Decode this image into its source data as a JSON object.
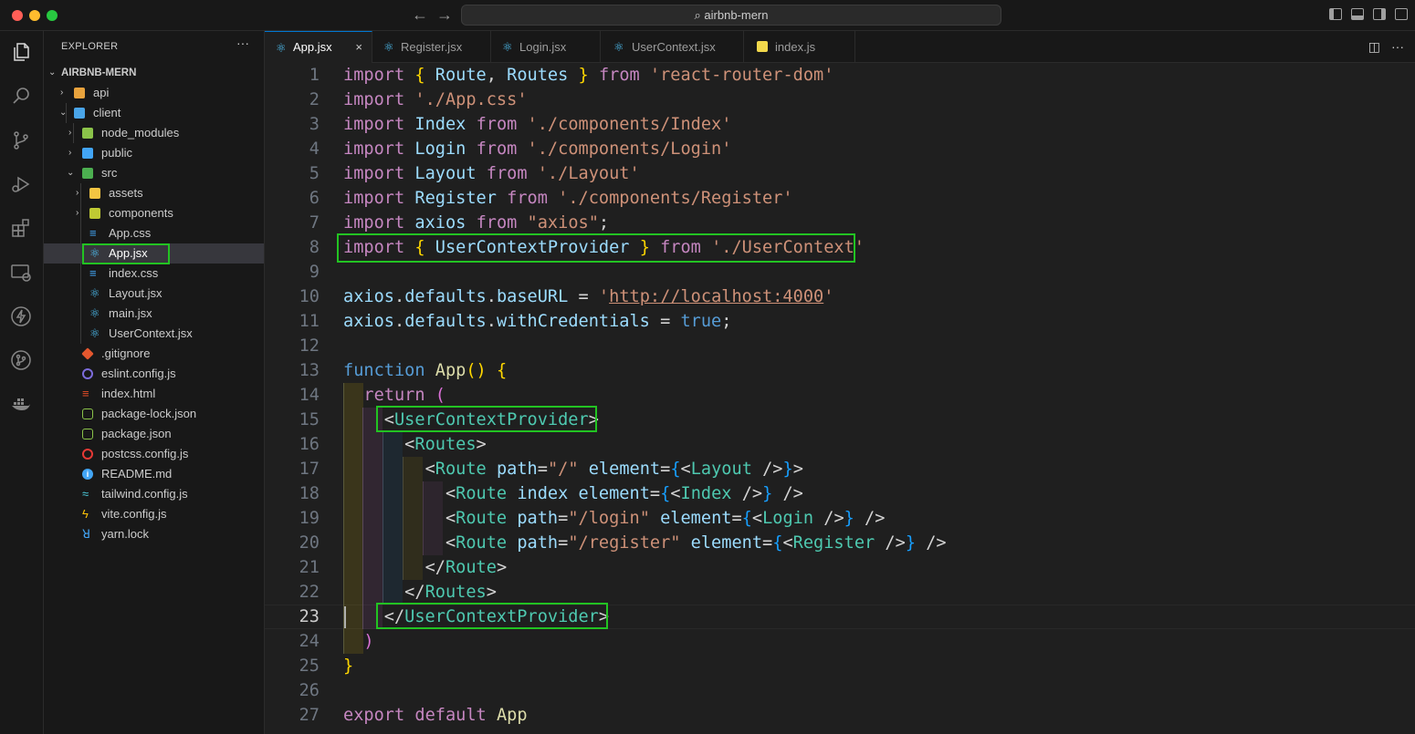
{
  "window": {
    "search_text": "airbnb-mern",
    "back_icon": "arrow-left-icon",
    "forward_icon": "arrow-right-icon"
  },
  "colors": {
    "traffic_close": "#ff5f57",
    "traffic_minimize": "#febc2e",
    "traffic_zoom": "#28c840",
    "annotation_highlight": "#22c322",
    "active_tab_border": "#0078d4"
  },
  "activity_bar": [
    {
      "name": "explorer-icon"
    },
    {
      "name": "search-icon"
    },
    {
      "name": "source-control-icon"
    },
    {
      "name": "run-debug-icon"
    },
    {
      "name": "extensions-icon"
    },
    {
      "name": "remote-explorer-icon"
    },
    {
      "name": "thunder-client-icon"
    },
    {
      "name": "git-graph-icon"
    },
    {
      "name": "docker-icon"
    }
  ],
  "sidebar": {
    "title": "EXPLORER",
    "more": "···",
    "root": "AIRBNB-MERN",
    "items": [
      {
        "label": "api"
      },
      {
        "label": "client"
      },
      {
        "label": "node_modules"
      },
      {
        "label": "public"
      },
      {
        "label": "src"
      },
      {
        "label": "assets"
      },
      {
        "label": "components"
      },
      {
        "label": "App.css"
      },
      {
        "label": "App.jsx"
      },
      {
        "label": "index.css"
      },
      {
        "label": "Layout.jsx"
      },
      {
        "label": "main.jsx"
      },
      {
        "label": "UserContext.jsx"
      },
      {
        "label": ".gitignore"
      },
      {
        "label": "eslint.config.js"
      },
      {
        "label": "index.html"
      },
      {
        "label": "package-lock.json"
      },
      {
        "label": "package.json"
      },
      {
        "label": "postcss.config.js"
      },
      {
        "label": "README.md"
      },
      {
        "label": "tailwind.config.js"
      },
      {
        "label": "vite.config.js"
      },
      {
        "label": "yarn.lock"
      }
    ]
  },
  "tabs": [
    {
      "label": "App.jsx",
      "close": "×"
    },
    {
      "label": "Register.jsx"
    },
    {
      "label": "Login.jsx"
    },
    {
      "label": "UserContext.jsx"
    },
    {
      "label": "index.js"
    }
  ],
  "editor": {
    "current_line": 23,
    "lines": [
      {
        "n": "1",
        "tokens": [
          [
            "kw",
            "import"
          ],
          [
            "plain",
            " "
          ],
          [
            "br1",
            "{"
          ],
          [
            "plain",
            " "
          ],
          [
            "var",
            "Route"
          ],
          [
            "plain",
            ", "
          ],
          [
            "var",
            "Routes"
          ],
          [
            "plain",
            " "
          ],
          [
            "br1",
            "}"
          ],
          [
            "plain",
            " "
          ],
          [
            "kw",
            "from"
          ],
          [
            "plain",
            " "
          ],
          [
            "str",
            "'react-router-dom'"
          ]
        ]
      },
      {
        "n": "2",
        "tokens": [
          [
            "kw",
            "import"
          ],
          [
            "plain",
            " "
          ],
          [
            "str",
            "'./App.css'"
          ]
        ]
      },
      {
        "n": "3",
        "tokens": [
          [
            "kw",
            "import"
          ],
          [
            "plain",
            " "
          ],
          [
            "var",
            "Index"
          ],
          [
            "plain",
            " "
          ],
          [
            "kw",
            "from"
          ],
          [
            "plain",
            " "
          ],
          [
            "str",
            "'./components/Index'"
          ]
        ]
      },
      {
        "n": "4",
        "tokens": [
          [
            "kw",
            "import"
          ],
          [
            "plain",
            " "
          ],
          [
            "var",
            "Login"
          ],
          [
            "plain",
            " "
          ],
          [
            "kw",
            "from"
          ],
          [
            "plain",
            " "
          ],
          [
            "str",
            "'./components/Login'"
          ]
        ]
      },
      {
        "n": "5",
        "tokens": [
          [
            "kw",
            "import"
          ],
          [
            "plain",
            " "
          ],
          [
            "var",
            "Layout"
          ],
          [
            "plain",
            " "
          ],
          [
            "kw",
            "from"
          ],
          [
            "plain",
            " "
          ],
          [
            "str",
            "'./Layout'"
          ]
        ]
      },
      {
        "n": "6",
        "tokens": [
          [
            "kw",
            "import"
          ],
          [
            "plain",
            " "
          ],
          [
            "var",
            "Register"
          ],
          [
            "plain",
            " "
          ],
          [
            "kw",
            "from"
          ],
          [
            "plain",
            " "
          ],
          [
            "str",
            "'./components/Register'"
          ]
        ]
      },
      {
        "n": "7",
        "tokens": [
          [
            "kw",
            "import"
          ],
          [
            "plain",
            " "
          ],
          [
            "var",
            "axios"
          ],
          [
            "plain",
            " "
          ],
          [
            "kw",
            "from"
          ],
          [
            "plain",
            " "
          ],
          [
            "str",
            "\"axios\""
          ],
          [
            "plain",
            ";"
          ]
        ]
      },
      {
        "n": "8",
        "tokens": [
          [
            "kw",
            "import"
          ],
          [
            "plain",
            " "
          ],
          [
            "br1",
            "{"
          ],
          [
            "plain",
            " "
          ],
          [
            "var",
            "UserContextProvider"
          ],
          [
            "plain",
            " "
          ],
          [
            "br1",
            "}"
          ],
          [
            "plain",
            " "
          ],
          [
            "kw",
            "from"
          ],
          [
            "plain",
            " "
          ],
          [
            "str",
            "'./UserContext'"
          ]
        ]
      },
      {
        "n": "9",
        "tokens": []
      },
      {
        "n": "10",
        "tokens": [
          [
            "var",
            "axios"
          ],
          [
            "plain",
            "."
          ],
          [
            "var",
            "defaults"
          ],
          [
            "plain",
            "."
          ],
          [
            "var",
            "baseURL"
          ],
          [
            "plain",
            " = "
          ],
          [
            "str",
            "'"
          ],
          [
            "str url",
            "http://localhost:4000"
          ],
          [
            "str",
            "'"
          ]
        ]
      },
      {
        "n": "11",
        "tokens": [
          [
            "var",
            "axios"
          ],
          [
            "plain",
            "."
          ],
          [
            "var",
            "defaults"
          ],
          [
            "plain",
            "."
          ],
          [
            "var",
            "withCredentials"
          ],
          [
            "plain",
            " = "
          ],
          [
            "bl",
            "true"
          ],
          [
            "plain",
            ";"
          ]
        ]
      },
      {
        "n": "12",
        "tokens": []
      },
      {
        "n": "13",
        "tokens": [
          [
            "bl",
            "function"
          ],
          [
            "plain",
            " "
          ],
          [
            "fn",
            "App"
          ],
          [
            "br1",
            "()"
          ],
          [
            "plain",
            " "
          ],
          [
            "br1",
            "{"
          ]
        ]
      },
      {
        "n": "14",
        "tokens": [
          [
            "plain",
            "  "
          ],
          [
            "kw",
            "return"
          ],
          [
            "plain",
            " "
          ],
          [
            "br2",
            "("
          ]
        ]
      },
      {
        "n": "15",
        "tokens": [
          [
            "plain",
            "    "
          ],
          [
            "plain",
            "<"
          ],
          [
            "tag",
            "UserContextProvider"
          ],
          [
            "plain",
            ">"
          ]
        ]
      },
      {
        "n": "16",
        "tokens": [
          [
            "plain",
            "      "
          ],
          [
            "plain",
            "<"
          ],
          [
            "tag",
            "Routes"
          ],
          [
            "plain",
            ">"
          ]
        ]
      },
      {
        "n": "17",
        "tokens": [
          [
            "plain",
            "        "
          ],
          [
            "plain",
            "<"
          ],
          [
            "tag",
            "Route"
          ],
          [
            "plain",
            " "
          ],
          [
            "var",
            "path"
          ],
          [
            "plain",
            "="
          ],
          [
            "str",
            "\"/\""
          ],
          [
            "plain",
            " "
          ],
          [
            "var",
            "element"
          ],
          [
            "plain",
            "="
          ],
          [
            "br3",
            "{"
          ],
          [
            "plain",
            "<"
          ],
          [
            "tag",
            "Layout"
          ],
          [
            "plain",
            " />"
          ],
          [
            "br3",
            "}"
          ],
          [
            "plain",
            ">"
          ]
        ]
      },
      {
        "n": "18",
        "tokens": [
          [
            "plain",
            "          "
          ],
          [
            "plain",
            "<"
          ],
          [
            "tag",
            "Route"
          ],
          [
            "plain",
            " "
          ],
          [
            "var",
            "index"
          ],
          [
            "plain",
            " "
          ],
          [
            "var",
            "element"
          ],
          [
            "plain",
            "="
          ],
          [
            "br3",
            "{"
          ],
          [
            "plain",
            "<"
          ],
          [
            "tag",
            "Index"
          ],
          [
            "plain",
            " />"
          ],
          [
            "br3",
            "}"
          ],
          [
            "plain",
            " />"
          ]
        ]
      },
      {
        "n": "19",
        "tokens": [
          [
            "plain",
            "          "
          ],
          [
            "plain",
            "<"
          ],
          [
            "tag",
            "Route"
          ],
          [
            "plain",
            " "
          ],
          [
            "var",
            "path"
          ],
          [
            "plain",
            "="
          ],
          [
            "str",
            "\"/login\""
          ],
          [
            "plain",
            " "
          ],
          [
            "var",
            "element"
          ],
          [
            "plain",
            "="
          ],
          [
            "br3",
            "{"
          ],
          [
            "plain",
            "<"
          ],
          [
            "tag",
            "Login"
          ],
          [
            "plain",
            " />"
          ],
          [
            "br3",
            "}"
          ],
          [
            "plain",
            " />"
          ]
        ]
      },
      {
        "n": "20",
        "tokens": [
          [
            "plain",
            "          "
          ],
          [
            "plain",
            "<"
          ],
          [
            "tag",
            "Route"
          ],
          [
            "plain",
            " "
          ],
          [
            "var",
            "path"
          ],
          [
            "plain",
            "="
          ],
          [
            "str",
            "\"/register\""
          ],
          [
            "plain",
            " "
          ],
          [
            "var",
            "element"
          ],
          [
            "plain",
            "="
          ],
          [
            "br3",
            "{"
          ],
          [
            "plain",
            "<"
          ],
          [
            "tag",
            "Register"
          ],
          [
            "plain",
            " />"
          ],
          [
            "br3",
            "}"
          ],
          [
            "plain",
            " />"
          ]
        ]
      },
      {
        "n": "21",
        "tokens": [
          [
            "plain",
            "        "
          ],
          [
            "plain",
            "</"
          ],
          [
            "tag",
            "Route"
          ],
          [
            "plain",
            ">"
          ]
        ]
      },
      {
        "n": "22",
        "tokens": [
          [
            "plain",
            "      "
          ],
          [
            "plain",
            "</"
          ],
          [
            "tag",
            "Routes"
          ],
          [
            "plain",
            ">"
          ]
        ]
      },
      {
        "n": "23",
        "tokens": [
          [
            "plain",
            "    "
          ],
          [
            "plain",
            "</"
          ],
          [
            "tag",
            "UserContextProvider"
          ],
          [
            "plain",
            ">"
          ]
        ]
      },
      {
        "n": "24",
        "tokens": [
          [
            "plain",
            "  "
          ],
          [
            "br2",
            ")"
          ]
        ]
      },
      {
        "n": "25",
        "tokens": [
          [
            "br1",
            "}"
          ]
        ]
      },
      {
        "n": "26",
        "tokens": []
      },
      {
        "n": "27",
        "tokens": [
          [
            "kw",
            "export"
          ],
          [
            "plain",
            " "
          ],
          [
            "kw",
            "default"
          ],
          [
            "plain",
            " "
          ],
          [
            "fn",
            "App"
          ]
        ]
      }
    ]
  }
}
